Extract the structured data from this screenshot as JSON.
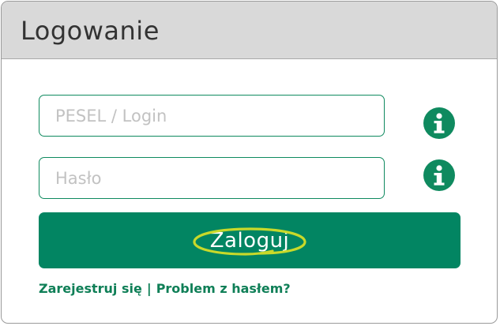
{
  "panel": {
    "title": "Logowanie"
  },
  "form": {
    "login_placeholder": "PESEL / Login",
    "login_value": "",
    "password_placeholder": "Hasło",
    "password_value": "",
    "submit_label": "Zaloguj"
  },
  "links": {
    "register": "Zarejestruj się",
    "separator": "|",
    "password_problem": "Problem z hasłem?"
  },
  "icons": {
    "login_info": "info-icon",
    "password_info": "info-icon",
    "highlight": "hand-drawn-ellipse"
  },
  "colors": {
    "accent": "#028562",
    "header_bg": "#d9d9d9",
    "highlight": "#c8d92a"
  }
}
